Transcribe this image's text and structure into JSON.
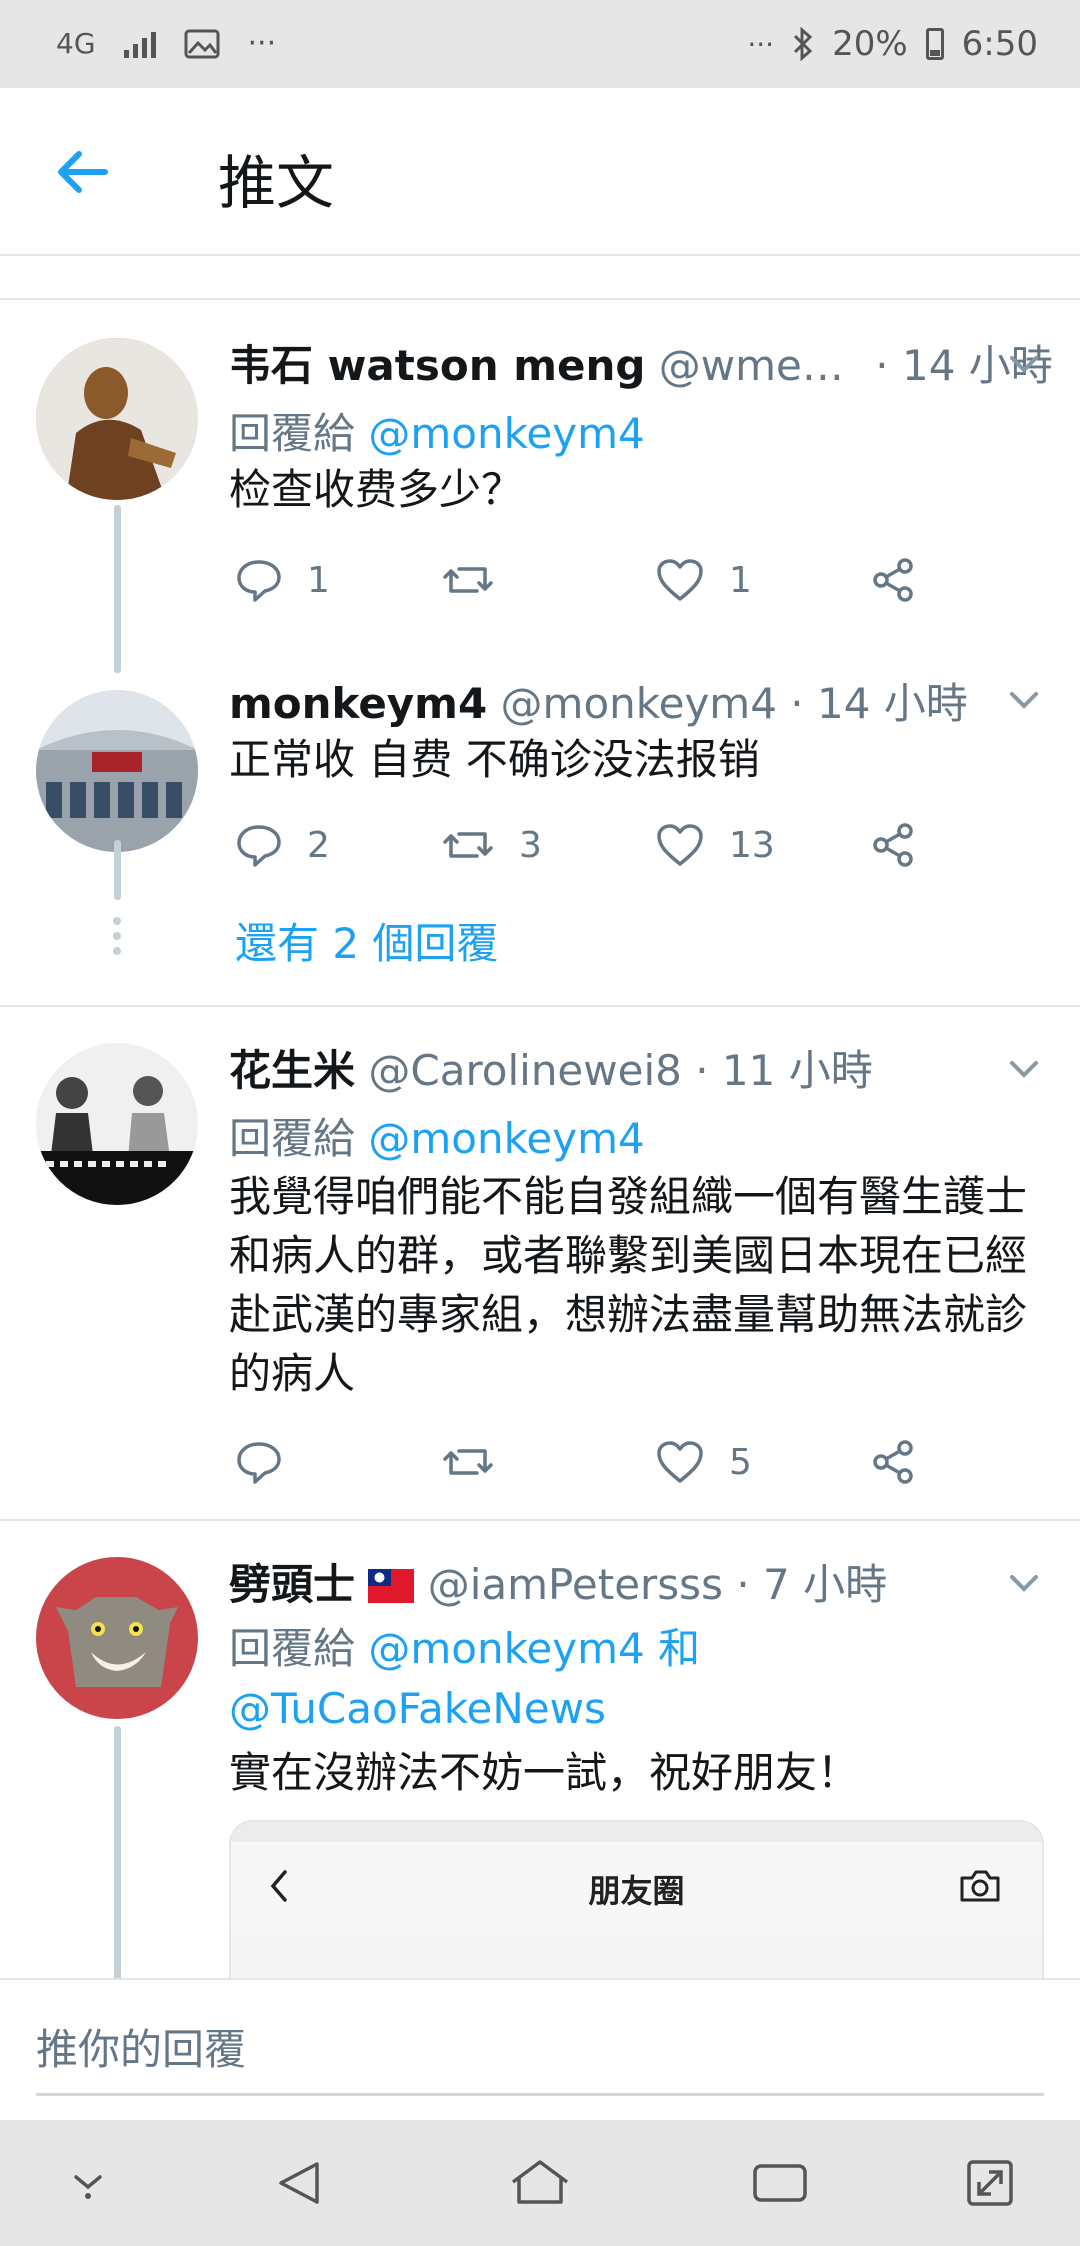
{
  "status_bar": {
    "network": "4G",
    "more": "···",
    "more_right": "···",
    "battery": "20%",
    "time": "6:50"
  },
  "header": {
    "title": "推文"
  },
  "tweets": [
    {
      "name": "韦石 watson meng",
      "handle": "@wme…",
      "time": "· 14 小時",
      "reply_prefix": "回覆給",
      "reply_to": "@monkeym4",
      "text": "检查收费多少？",
      "reply_count": "1",
      "retweet_count": "",
      "like_count": "1"
    },
    {
      "name": "monkeym4",
      "handle": "@monkeym4",
      "time": "· 14 小時",
      "text": "正常收 自费 不确诊没法报销",
      "reply_count": "2",
      "retweet_count": "3",
      "like_count": "13",
      "more_replies": "還有 2 個回覆"
    },
    {
      "name": "花生米",
      "handle": "@Carolinewei8",
      "time": "· 11 小時",
      "reply_prefix": "回覆給",
      "reply_to": "@monkeym4",
      "text": "我覺得咱們能不能自發組織一個有醫生護士和病人的群，或者聯繫到美國日本現在已經赴武漢的專家組，想辦法盡量幫助無法就診的病人",
      "reply_count": "",
      "retweet_count": "",
      "like_count": "5"
    },
    {
      "name": "劈頭士",
      "flag": "taiwan-flag",
      "handle": "@iamPetersss",
      "time": "· 7 小時",
      "reply_prefix": "回覆給",
      "reply_to": "@monkeym4",
      "reply_and": "和",
      "reply_to_2": "@TuCaoFakeNews",
      "text": "實在沒辦法不妨一試，祝好朋友！",
      "embed_title": "朋友圈"
    }
  ],
  "reply_bar": {
    "placeholder": "推你的回覆"
  },
  "colors": {
    "accent": "#1da1f2",
    "secondary": "#657786",
    "divider": "#e1e8ed"
  }
}
